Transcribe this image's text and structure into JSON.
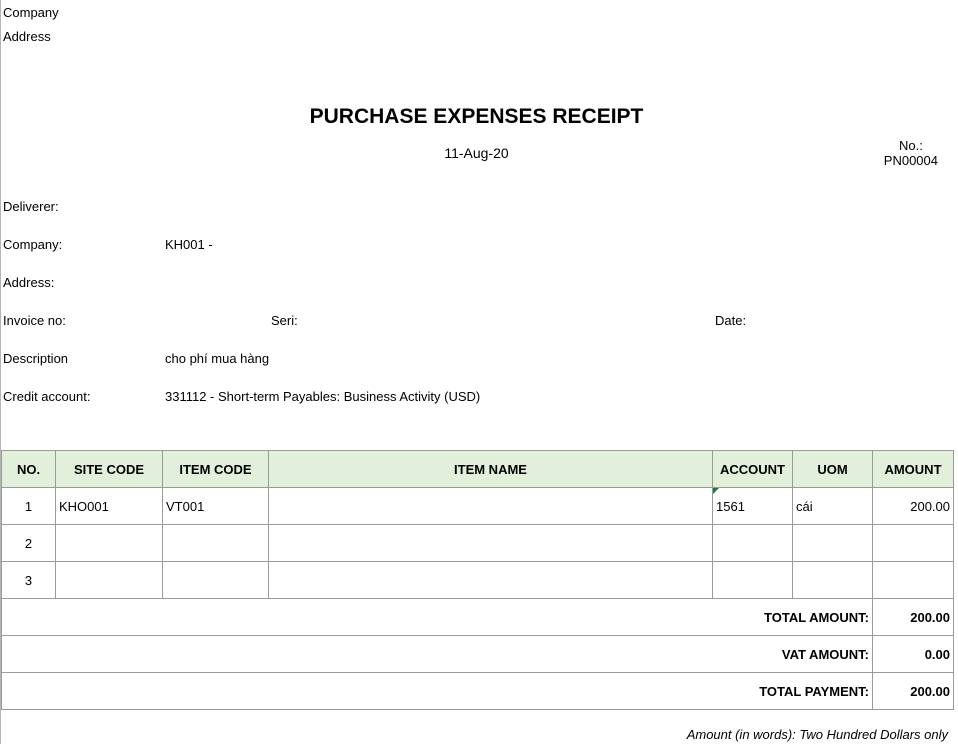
{
  "header": {
    "company_label": "Company",
    "address_label": "Address"
  },
  "title": "PURCHASE EXPENSES RECEIPT",
  "date": "11-Aug-20",
  "voucher": {
    "no_label": "No.:",
    "no_value": "PN00004"
  },
  "info": {
    "deliverer_label": "Deliverer:",
    "deliverer_value": "",
    "company_label": "Company:",
    "company_value": "KH001 -",
    "address_label": "Address:",
    "address_value": "",
    "invoice_label": "Invoice no:",
    "seri_label": "Seri:",
    "date_label": "Date:",
    "description_label": "Description",
    "description_value": "cho phí mua hàng",
    "credit_label": "Credit account:",
    "credit_value": "331112 - Short-term Payables: Business Activity (USD)"
  },
  "table": {
    "headers": [
      "NO.",
      "SITE CODE",
      "ITEM CODE",
      "ITEM NAME",
      "ACCOUNT",
      "UOM",
      "AMOUNT"
    ],
    "rows": [
      [
        "1",
        "KHO001",
        "VT001",
        "",
        "1561",
        "cái",
        "200.00"
      ],
      [
        "2",
        "",
        "",
        "",
        "",
        "",
        ""
      ],
      [
        "3",
        "",
        "",
        "",
        "",
        "",
        ""
      ]
    ]
  },
  "totals": {
    "total_amount_label": "TOTAL AMOUNT:",
    "total_amount_value": "200.00",
    "vat_label": "VAT AMOUNT:",
    "vat_value": "0.00",
    "payment_label": "TOTAL PAYMENT:",
    "payment_value": "200.00"
  },
  "amount_in_words": "Amount (in words): Two Hundred Dollars only"
}
